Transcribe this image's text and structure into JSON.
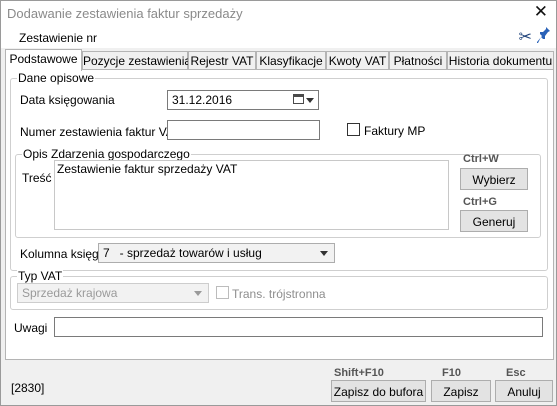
{
  "window": {
    "title": "Dodawanie zestawienia faktur sprzedaży",
    "subtitle": "Zestawienie nr",
    "close_symbol": "✕",
    "cut_symbol": "✂",
    "pin_symbol": "📌"
  },
  "tabs": [
    {
      "label": "Podstawowe",
      "active": true
    },
    {
      "label": "Pozycje zestawienia",
      "active": false
    },
    {
      "label": "Rejestr VAT",
      "active": false
    },
    {
      "label": "Klasyfikacje",
      "active": false
    },
    {
      "label": "Kwoty VAT",
      "active": false
    },
    {
      "label": "Płatności",
      "active": false
    },
    {
      "label": "Historia dokumentu",
      "active": false
    }
  ],
  "dane_opisowe": {
    "title": "Dane opisowe",
    "data_ksiegowania_label": "Data księgowania",
    "data_ksiegowania_value": "31.12.2016",
    "numer_label": "Numer zestawienia faktur VAT",
    "numer_value": "",
    "faktury_mp_label": "Faktury MP",
    "faktury_mp_checked": false
  },
  "opis": {
    "title": "Opis Zdarzenia gospodarczego",
    "tresc_label": "Treść",
    "tresc_value": "Zestawienie faktur sprzedaży VAT",
    "wybierz_hotkey": "Ctrl+W",
    "wybierz_label": "Wybierz",
    "generuj_hotkey": "Ctrl+G",
    "generuj_label": "Generuj"
  },
  "kolumna": {
    "label": "Kolumna księgi",
    "value": "7   - sprzedaż towarów i usług"
  },
  "typ_vat": {
    "title": "Typ VAT",
    "value": "Sprzedaż krajowa",
    "trans_label": "Trans. trójstronna",
    "trans_checked": false
  },
  "uwagi": {
    "label": "Uwagi",
    "value": ""
  },
  "footer": {
    "id": "[2830]",
    "save_buffer_hotkey": "Shift+F10",
    "save_buffer_label": "Zapisz do bufora",
    "save_hotkey": "F10",
    "save_label": "Zapisz",
    "cancel_hotkey": "Esc",
    "cancel_label": "Anuluj"
  }
}
